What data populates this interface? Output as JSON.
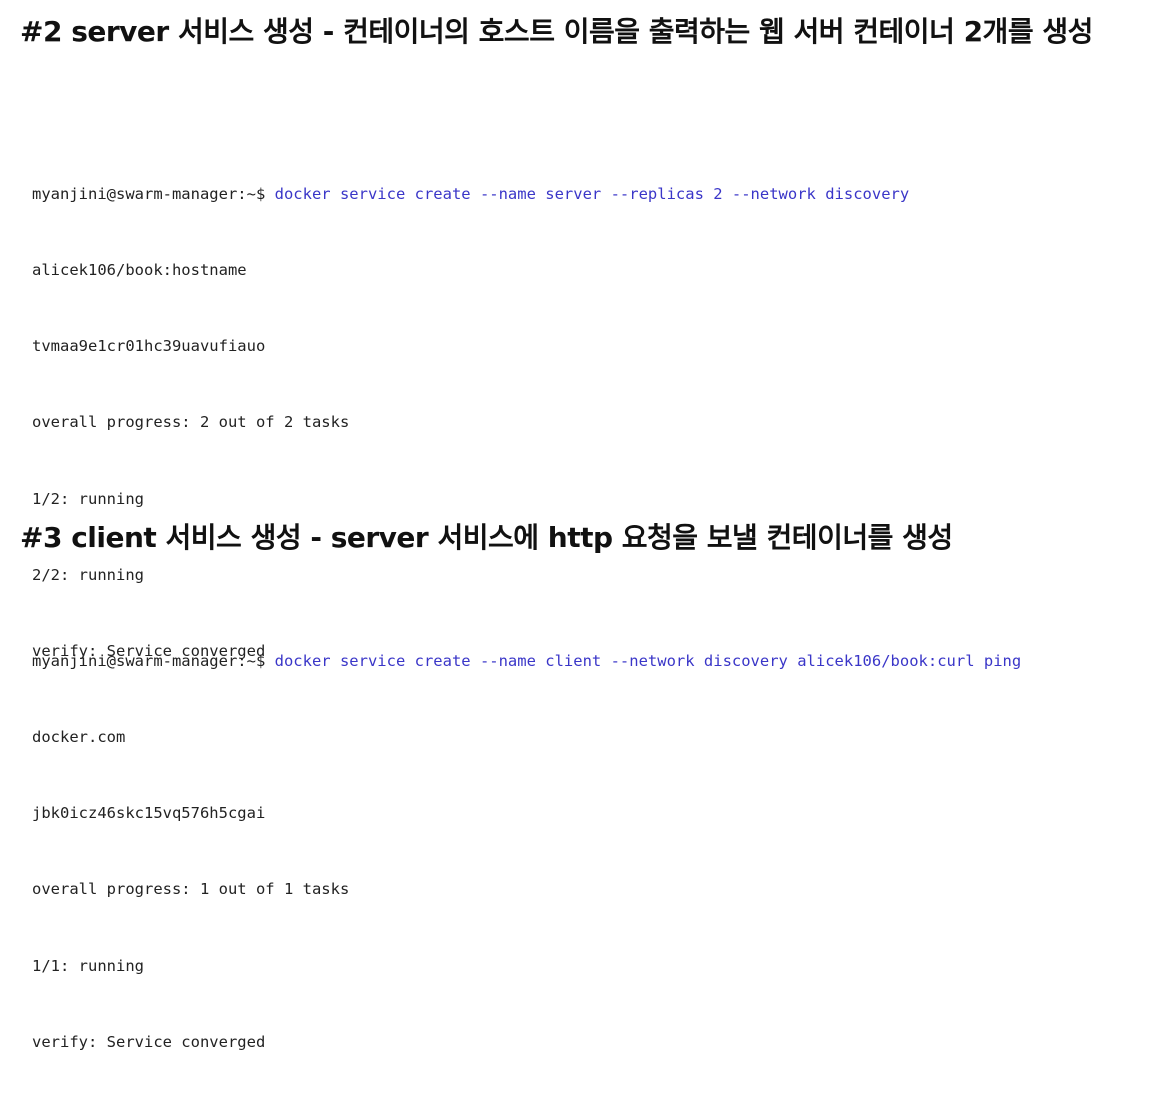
{
  "section2": {
    "heading": "#2 server 서비스 생성 - 컨테이너의 호스트 이름을 출력하는 웹 서버 컨테이너 2개를 생성",
    "terminal": {
      "prompt": "myanjini@swarm-manager:~$ ",
      "command": "docker service create --name server --replicas 2 --network discovery",
      "output": [
        "alicek106/book:hostname",
        "tvmaa9e1cr01hc39uavufiauo",
        "overall progress: 2 out of 2 tasks",
        "1/2: running",
        "2/2: running",
        "verify: Service converged"
      ]
    }
  },
  "section3": {
    "heading": "#3 client 서비스 생성 - server 서비스에 http 요청을 보낼 컨테이너를 생성",
    "terminal": {
      "prompt": "myanjini@swarm-manager:~$ ",
      "command": "docker service create --name client --network discovery alicek106/book:curl ping",
      "output": [
        "docker.com",
        "jbk0icz46skc15vq576h5cgai",
        "overall progress: 1 out of 1 tasks",
        "1/1: running",
        "verify: Service converged"
      ]
    }
  },
  "colors": {
    "command": "#3a36c8",
    "text": "#222222",
    "background": "#ffffff"
  }
}
